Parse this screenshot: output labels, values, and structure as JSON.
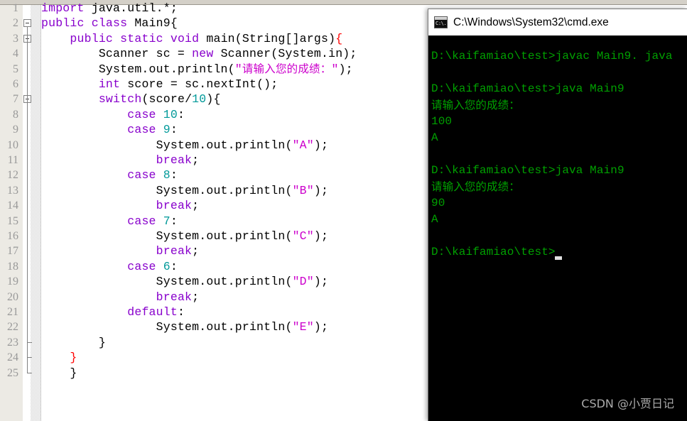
{
  "editor": {
    "name": "code-editor",
    "language": "java",
    "gutter_line_count": 25,
    "lines": [
      {
        "no": "1",
        "tokens": [
          {
            "t": "import ",
            "c": "kw"
          },
          {
            "t": "java.util.*;",
            "c": "plain"
          }
        ]
      },
      {
        "no": "2",
        "tokens": [
          {
            "t": "public class ",
            "c": "kw"
          },
          {
            "t": "Main9{",
            "c": "plain"
          }
        ]
      },
      {
        "no": "3",
        "tokens": [
          {
            "t": "    ",
            "c": "plain"
          },
          {
            "t": "public static void ",
            "c": "kw"
          },
          {
            "t": "main(String[]args)",
            "c": "plain"
          },
          {
            "t": "{",
            "c": "redb"
          }
        ]
      },
      {
        "no": "4",
        "tokens": [
          {
            "t": "        Scanner sc = ",
            "c": "plain"
          },
          {
            "t": "new ",
            "c": "kw"
          },
          {
            "t": "Scanner(System.in);",
            "c": "plain"
          }
        ]
      },
      {
        "no": "5",
        "tokens": [
          {
            "t": "        System.out.println(",
            "c": "plain"
          },
          {
            "t": "\"",
            "c": "str"
          },
          {
            "t": "请输入您的成绩：",
            "c": "cjk"
          },
          {
            "t": "\"",
            "c": "str"
          },
          {
            "t": ");",
            "c": "plain"
          }
        ]
      },
      {
        "no": "6",
        "tokens": [
          {
            "t": "        ",
            "c": "plain"
          },
          {
            "t": "int ",
            "c": "kw"
          },
          {
            "t": "score = sc.nextInt();",
            "c": "plain"
          }
        ]
      },
      {
        "no": "7",
        "tokens": [
          {
            "t": "        ",
            "c": "plain"
          },
          {
            "t": "switch",
            "c": "kw"
          },
          {
            "t": "(score/",
            "c": "plain"
          },
          {
            "t": "10",
            "c": "num"
          },
          {
            "t": "){",
            "c": "plain"
          }
        ]
      },
      {
        "no": "8",
        "tokens": [
          {
            "t": "            ",
            "c": "plain"
          },
          {
            "t": "case ",
            "c": "kw"
          },
          {
            "t": "10",
            "c": "num"
          },
          {
            "t": ":",
            "c": "plain"
          }
        ]
      },
      {
        "no": "9",
        "tokens": [
          {
            "t": "            ",
            "c": "plain"
          },
          {
            "t": "case ",
            "c": "kw"
          },
          {
            "t": "9",
            "c": "num"
          },
          {
            "t": ":",
            "c": "plain"
          }
        ]
      },
      {
        "no": "10",
        "tokens": [
          {
            "t": "                System.out.println(",
            "c": "plain"
          },
          {
            "t": "\"A\"",
            "c": "str"
          },
          {
            "t": ");",
            "c": "plain"
          }
        ]
      },
      {
        "no": "11",
        "tokens": [
          {
            "t": "                ",
            "c": "plain"
          },
          {
            "t": "break",
            "c": "kw"
          },
          {
            "t": ";",
            "c": "plain"
          }
        ]
      },
      {
        "no": "12",
        "tokens": [
          {
            "t": "            ",
            "c": "plain"
          },
          {
            "t": "case ",
            "c": "kw"
          },
          {
            "t": "8",
            "c": "num"
          },
          {
            "t": ":",
            "c": "plain"
          }
        ]
      },
      {
        "no": "13",
        "tokens": [
          {
            "t": "                System.out.println(",
            "c": "plain"
          },
          {
            "t": "\"B\"",
            "c": "str"
          },
          {
            "t": ");",
            "c": "plain"
          }
        ]
      },
      {
        "no": "14",
        "tokens": [
          {
            "t": "                ",
            "c": "plain"
          },
          {
            "t": "break",
            "c": "kw"
          },
          {
            "t": ";",
            "c": "plain"
          }
        ]
      },
      {
        "no": "15",
        "tokens": [
          {
            "t": "            ",
            "c": "plain"
          },
          {
            "t": "case ",
            "c": "kw"
          },
          {
            "t": "7",
            "c": "num"
          },
          {
            "t": ":",
            "c": "plain"
          }
        ]
      },
      {
        "no": "16",
        "tokens": [
          {
            "t": "                System.out.println(",
            "c": "plain"
          },
          {
            "t": "\"C\"",
            "c": "str"
          },
          {
            "t": ");",
            "c": "plain"
          }
        ]
      },
      {
        "no": "17",
        "tokens": [
          {
            "t": "                ",
            "c": "plain"
          },
          {
            "t": "break",
            "c": "kw"
          },
          {
            "t": ";",
            "c": "plain"
          }
        ]
      },
      {
        "no": "18",
        "tokens": [
          {
            "t": "            ",
            "c": "plain"
          },
          {
            "t": "case ",
            "c": "kw"
          },
          {
            "t": "6",
            "c": "num"
          },
          {
            "t": ":",
            "c": "plain"
          }
        ]
      },
      {
        "no": "19",
        "tokens": [
          {
            "t": "                System.out.println(",
            "c": "plain"
          },
          {
            "t": "\"D\"",
            "c": "str"
          },
          {
            "t": ");",
            "c": "plain"
          }
        ]
      },
      {
        "no": "20",
        "tokens": [
          {
            "t": "                ",
            "c": "plain"
          },
          {
            "t": "break",
            "c": "kw"
          },
          {
            "t": ";",
            "c": "plain"
          }
        ]
      },
      {
        "no": "21",
        "tokens": [
          {
            "t": "            ",
            "c": "plain"
          },
          {
            "t": "default",
            "c": "kw"
          },
          {
            "t": ":",
            "c": "plain"
          }
        ]
      },
      {
        "no": "22",
        "tokens": [
          {
            "t": "                System.out.println(",
            "c": "plain"
          },
          {
            "t": "\"E\"",
            "c": "str"
          },
          {
            "t": ");",
            "c": "plain"
          }
        ]
      },
      {
        "no": "23",
        "tokens": [
          {
            "t": "        }",
            "c": "plain"
          }
        ]
      },
      {
        "no": "24",
        "tokens": [
          {
            "t": "    }",
            "c": "redb"
          }
        ]
      },
      {
        "no": "25",
        "tokens": [
          {
            "t": "    }",
            "c": "plain"
          }
        ]
      }
    ],
    "fold_markers_at_lines": [
      2,
      3,
      7
    ],
    "fold_end_lines": [
      23,
      24,
      25
    ],
    "colors": {
      "keyword": "#8800cc",
      "number": "#009999",
      "string": "#cc00cc",
      "bracket_highlight": "#ff0000",
      "text": "#000000",
      "gutter_bg": "#eceae4",
      "lineno": "#999999"
    }
  },
  "console": {
    "title": "C:\\Windows\\System32\\cmd.exe",
    "icon": "cmd-console-icon",
    "icon_glyph": "C:\\.",
    "text_color": "#00a000",
    "background": "#000000",
    "lines": [
      {
        "text": "D:\\kaifamiao\\test>javac Main9. java",
        "cjk": false
      },
      {
        "text": "",
        "cjk": false
      },
      {
        "text": "D:\\kaifamiao\\test>java Main9",
        "cjk": false
      },
      {
        "text": "请输入您的成绩：",
        "cjk": true
      },
      {
        "text": "100",
        "cjk": false
      },
      {
        "text": "A",
        "cjk": false
      },
      {
        "text": "",
        "cjk": false
      },
      {
        "text": "D:\\kaifamiao\\test>java Main9",
        "cjk": false
      },
      {
        "text": "请输入您的成绩：",
        "cjk": true
      },
      {
        "text": "90",
        "cjk": false
      },
      {
        "text": "A",
        "cjk": false
      },
      {
        "text": "",
        "cjk": false
      },
      {
        "text": "D:\\kaifamiao\\test>",
        "cjk": false
      }
    ],
    "cursor": {
      "visible": true,
      "color": "#e0e0e0"
    }
  },
  "watermark": {
    "text": "CSDN @小贾日记",
    "color": "#c8c8c8"
  }
}
